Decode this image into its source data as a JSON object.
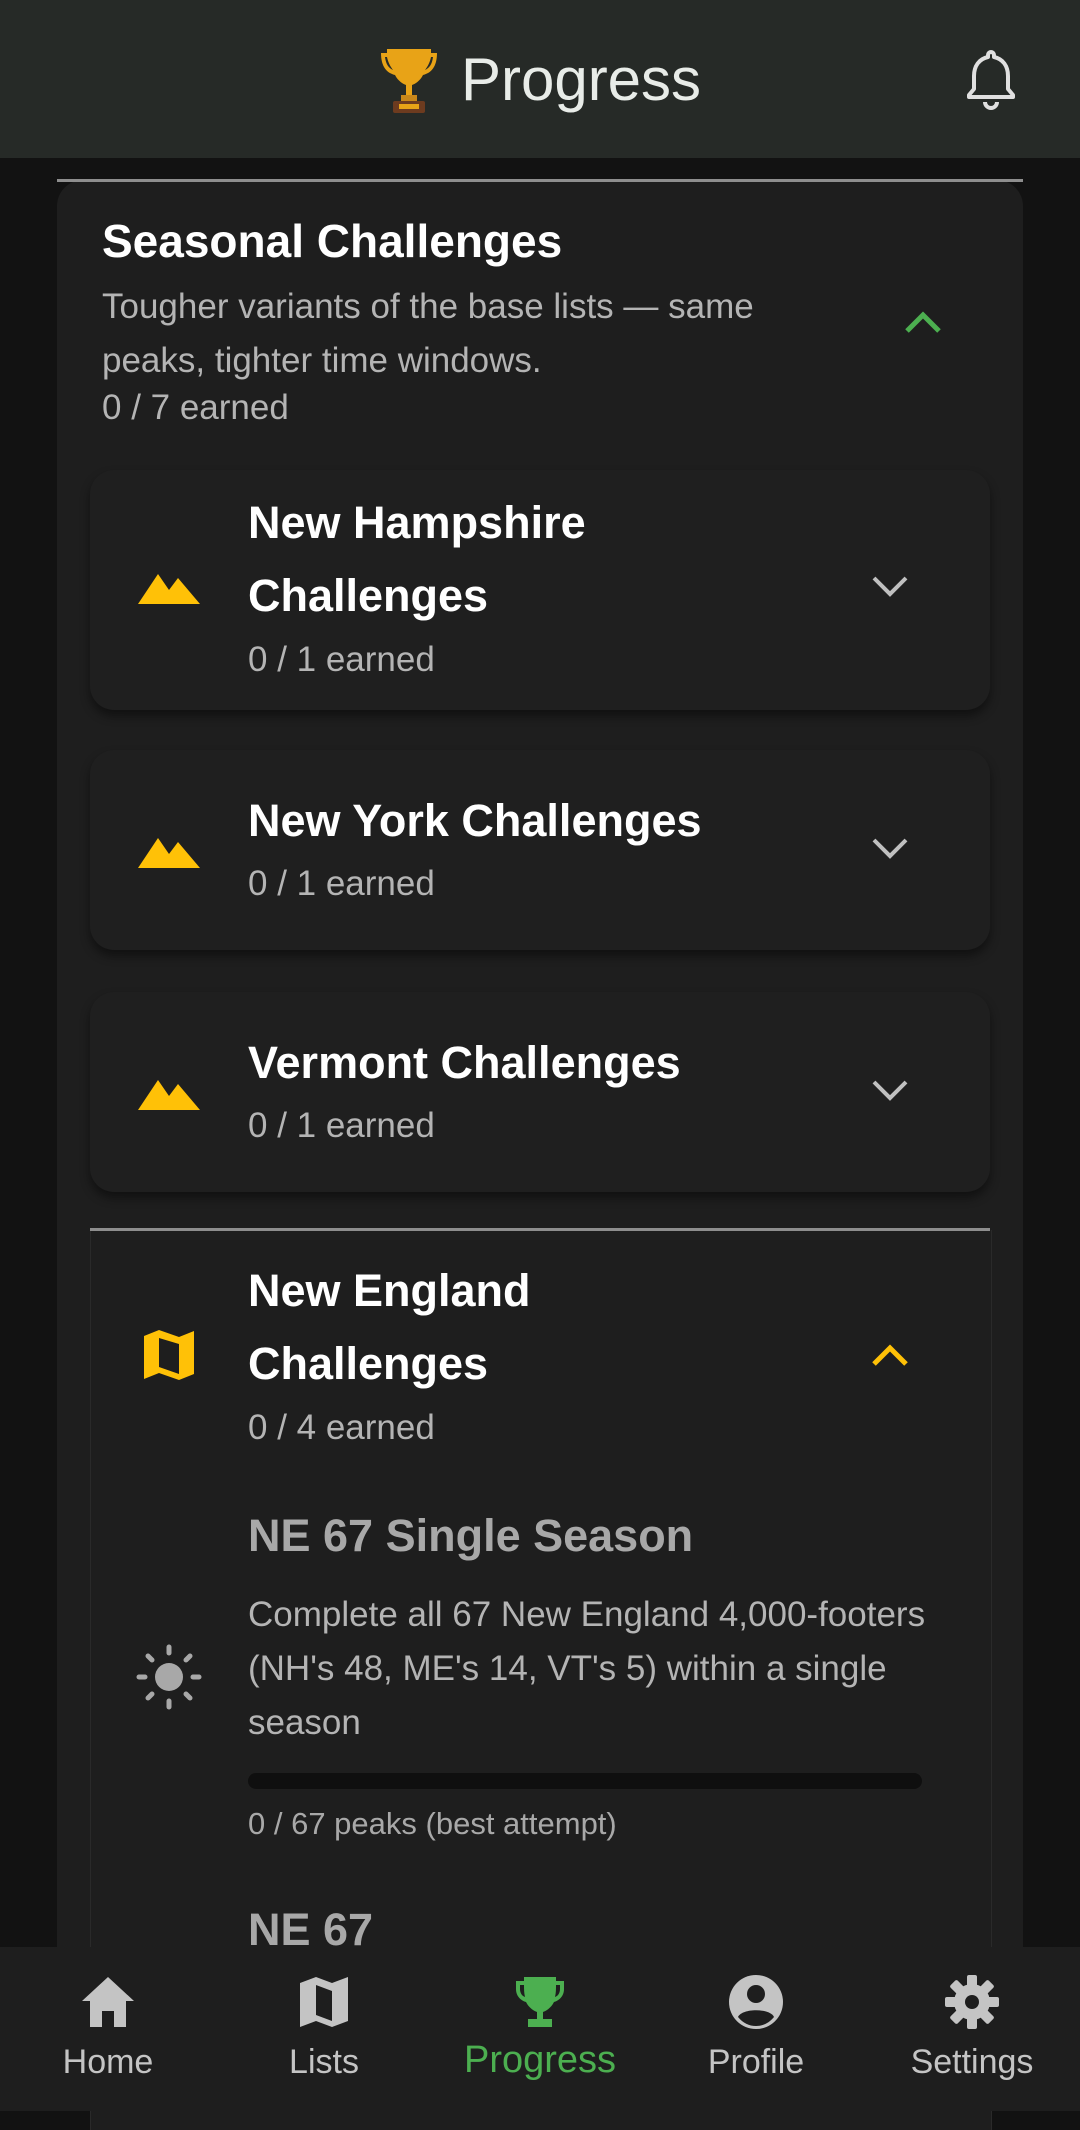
{
  "header": {
    "title": "Progress",
    "trophy_icon": "trophy-icon",
    "bell_icon": "bell-icon"
  },
  "seasonal": {
    "title": "Seasonal Challenges",
    "description": "Tougher variants of the base lists — same peaks, tighter time windows.",
    "earned": "0 / 7 earned",
    "accent": "#4caf50"
  },
  "groups": [
    {
      "title_line1": "New Hampshire",
      "title_line2": "Challenges",
      "earned": "0 / 1 earned",
      "icon": "mountain-icon"
    },
    {
      "title": "New York Challenges",
      "earned": "0 / 1 earned",
      "icon": "mountain-icon"
    },
    {
      "title": "Vermont Challenges",
      "earned": "0 / 1 earned",
      "icon": "mountain-icon"
    }
  ],
  "new_england": {
    "title_line1": "New England",
    "title_line2": "Challenges",
    "earned": "0 / 4 earned",
    "icon": "map-icon",
    "accent": "#ffc107",
    "items": [
      {
        "title": "NE 67 Single Season",
        "description": "Complete all 67 New England 4,000-footers (NH's 48, ME's 14, VT's 5) within a single season",
        "progress_fraction": 0,
        "progress_text": "0 / 67 peaks (best attempt)",
        "icon": "sun-icon"
      },
      {
        "title": "NE 67"
      }
    ]
  },
  "nav": [
    {
      "label": "Home",
      "icon": "home-icon"
    },
    {
      "label": "Lists",
      "icon": "map-icon"
    },
    {
      "label": "Progress",
      "icon": "trophy-icon",
      "active": true
    },
    {
      "label": "Profile",
      "icon": "account-icon"
    },
    {
      "label": "Settings",
      "icon": "gear-icon"
    }
  ]
}
